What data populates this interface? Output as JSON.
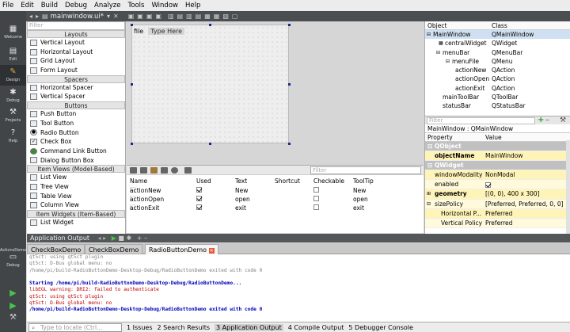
{
  "menu": [
    "File",
    "Edit",
    "Build",
    "Debug",
    "Analyze",
    "Tools",
    "Window",
    "Help"
  ],
  "modes": [
    "Welcome",
    "Edit",
    "Design",
    "Debug",
    "Projects",
    "Help"
  ],
  "kit": {
    "name": "ActionsDemo",
    "mode": "Debug"
  },
  "editor": {
    "document": "mainwindow.ui*"
  },
  "widgetbox": {
    "filter_placeholder": "Filter",
    "groups": [
      {
        "title": "Layouts",
        "items": [
          "Vertical Layout",
          "Horizontal Layout",
          "Grid Layout",
          "Form Layout"
        ]
      },
      {
        "title": "Spacers",
        "items": [
          "Horizontal Spacer",
          "Vertical Spacer"
        ]
      },
      {
        "title": "Buttons",
        "items": [
          "Push Button",
          "Tool Button",
          "Radio Button",
          "Check Box",
          "Command Link Button",
          "Dialog Button Box"
        ]
      },
      {
        "title": "Item Views (Model-Based)",
        "items": [
          "List View",
          "Tree View",
          "Table View",
          "Column View"
        ]
      },
      {
        "title": "Item Widgets (Item-Based)",
        "items": [
          "List Widget"
        ]
      }
    ]
  },
  "form": {
    "menu_items": [
      "file",
      "Type Here"
    ]
  },
  "actions": {
    "filter_placeholder": "Filter",
    "columns": [
      "Name",
      "Used",
      "Text",
      "Shortcut",
      "Checkable",
      "ToolTip"
    ],
    "rows": [
      {
        "name": "actionNew",
        "used": true,
        "text": "New",
        "tooltip": "New"
      },
      {
        "name": "actionOpen",
        "used": true,
        "text": "open",
        "tooltip": "open"
      },
      {
        "name": "actionExit",
        "used": true,
        "text": "exit",
        "tooltip": "exit"
      }
    ]
  },
  "objects": {
    "columns": [
      "Object",
      "Class"
    ],
    "rows": [
      {
        "obj": "MainWindow",
        "cls": "QMainWindow"
      },
      {
        "obj": "centralWidget",
        "cls": "QWidget"
      },
      {
        "obj": "menuBar",
        "cls": "QMenuBar"
      },
      {
        "obj": "menuFile",
        "cls": "QMenu"
      },
      {
        "obj": "actionNew",
        "cls": "QAction"
      },
      {
        "obj": "actionOpen",
        "cls": "QAction"
      },
      {
        "obj": "actionExit",
        "cls": "QAction"
      },
      {
        "obj": "mainToolBar",
        "cls": "QToolBar"
      },
      {
        "obj": "statusBar",
        "cls": "QStatusBar"
      }
    ]
  },
  "properties": {
    "filter_placeholder": "Filter",
    "title": "MainWindow : QMainWindow",
    "columns": [
      "Property",
      "Value"
    ],
    "rows": [
      {
        "p": "QObject",
        "v": ""
      },
      {
        "p": "objectName",
        "v": "MainWindow"
      },
      {
        "p": "QWidget",
        "v": ""
      },
      {
        "p": "windowModality",
        "v": "NonModal"
      },
      {
        "p": "enabled",
        "v": ""
      },
      {
        "p": "geometry",
        "v": "[(0, 0), 400 x 300]"
      },
      {
        "p": "sizePolicy",
        "v": "[Preferred, Preferred, 0, 0]"
      },
      {
        "p": "Horizontal P...",
        "v": "Preferred"
      },
      {
        "p": "Vertical Policy",
        "v": "Preferred"
      }
    ]
  },
  "app_output": {
    "title": "Application Output",
    "tabs": [
      "CheckBoxDemo",
      "CheckBoxDemo",
      "RadioButtonDemo"
    ],
    "lines": [
      "qt5ct: using qt5ct plugin",
      "qt5ct: D-Bus global menu: no",
      "/home/pi/build-RadioButtonDemo-Desktop-Debug/RadioButtonDemo exited with code 0",
      "",
      "Starting /home/pi/build-RadioButtonDemo-Desktop-Debug/RadioButtonDemo...",
      "libEGL warning: DRI2: failed to authenticate",
      "qt5ct: using qt5ct plugin",
      "qt5ct: D-Bus global menu: no",
      "/home/pi/build-RadioButtonDemo-Desktop-Debug/RadioButtonDemo exited with code 0"
    ]
  },
  "statusbar": {
    "locate_placeholder": "Type to locate (Ctrl...",
    "tabs": [
      "1 Issues",
      "2 Search Results",
      "3 Application Output",
      "4 Compile Output",
      "5 Debugger Console"
    ]
  },
  "colors": {
    "starting": "#0000b8",
    "warning": "#c00000",
    "dim": "#808080"
  }
}
